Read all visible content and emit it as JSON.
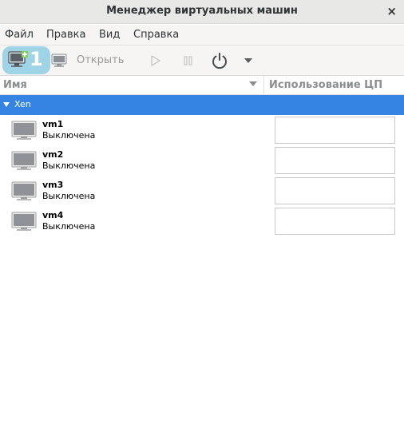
{
  "window": {
    "title": "Менеджер виртуальных машин",
    "close_icon": "×"
  },
  "menu": {
    "file": "Файл",
    "edit": "Правка",
    "view": "Вид",
    "help": "Справка"
  },
  "toolbar": {
    "new_badge": "1",
    "open_label": "Открыть",
    "accent": "#9fd3e6"
  },
  "columns": {
    "name": "Имя",
    "cpu": "Использование ЦП"
  },
  "group": {
    "name": "Xen",
    "color": "#3584e4"
  },
  "vms": [
    {
      "name": "vm1",
      "status": "Выключена"
    },
    {
      "name": "vm2",
      "status": "Выключена"
    },
    {
      "name": "vm3",
      "status": "Выключена"
    },
    {
      "name": "vm4",
      "status": "Выключена"
    }
  ]
}
